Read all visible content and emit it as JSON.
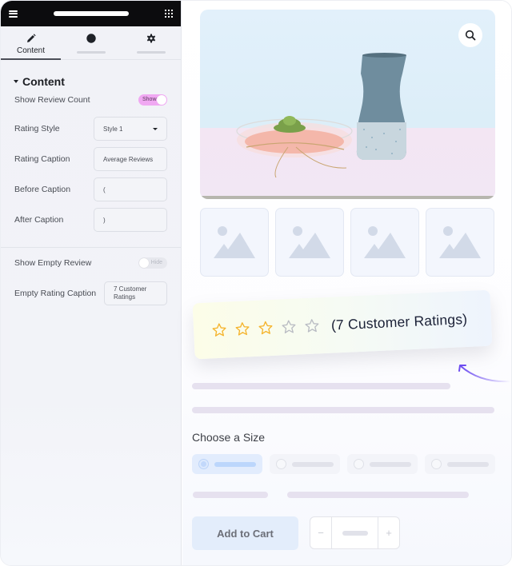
{
  "panel": {
    "tabs": [
      {
        "label": "Content",
        "icon": "pencil-icon",
        "active": true
      },
      {
        "label": "",
        "icon": "contrast-icon",
        "active": false
      },
      {
        "label": "",
        "icon": "gear-icon",
        "active": false
      }
    ],
    "section_title": "Content",
    "controls": {
      "show_review_count": {
        "label": "Show Review Count",
        "toggle": "Show",
        "state": "on"
      },
      "rating_style": {
        "label": "Rating Style",
        "value": "Style 1"
      },
      "rating_caption": {
        "label": "Rating Caption",
        "value": "Average Reviews"
      },
      "before_caption": {
        "label": "Before Caption",
        "value": "("
      },
      "after_caption": {
        "label": "After Caption",
        "value": ")"
      },
      "show_empty_review": {
        "label": "Show Empty Review",
        "toggle": "Hide",
        "state": "off"
      },
      "empty_rating_caption": {
        "label": "Empty Rating Caption",
        "value": "7 Customer Ratings"
      }
    }
  },
  "preview": {
    "rating": {
      "value": 3,
      "max": 5,
      "caption": "(7 Customer Ratings)",
      "star_color": "#f5b32b",
      "empty_star_color": "#b9bcc3"
    },
    "thumbnails": 4,
    "size_label": "Choose a Size",
    "size_options": 4,
    "selected_size_index": 0,
    "add_to_cart": "Add to Cart",
    "stepper": {
      "minus": "−",
      "plus": "+"
    },
    "accent_arrow_color": "#6d4cf0"
  }
}
